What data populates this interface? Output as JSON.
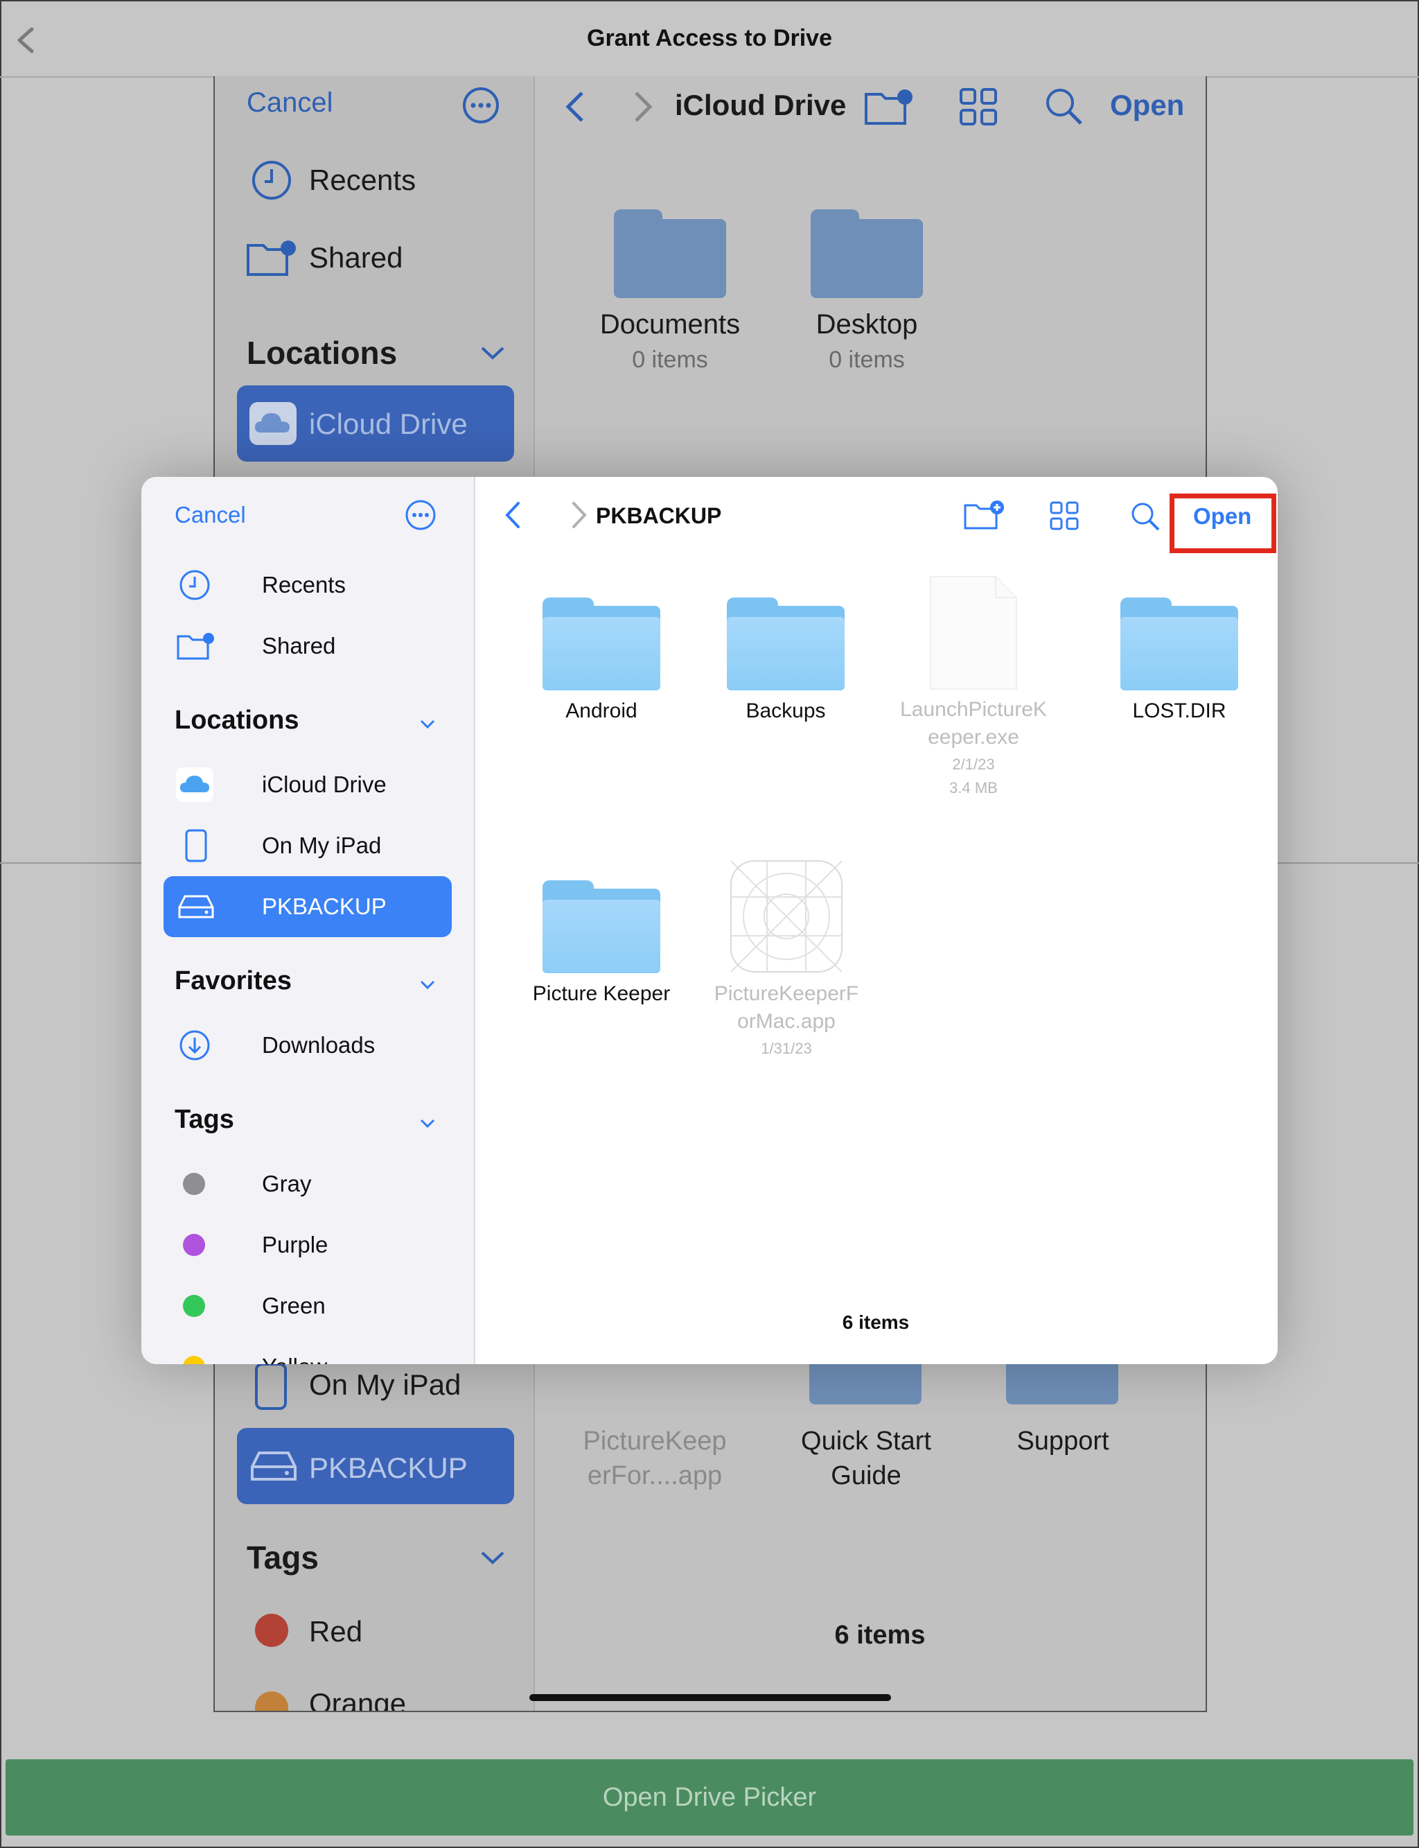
{
  "top_bar": {
    "title": "Grant Access to Drive"
  },
  "background_picker": {
    "cancel": "Cancel",
    "recents": "Recents",
    "shared": "Shared",
    "locations_header": "Locations",
    "icloud": "iCloud Drive",
    "on_my_ipad": "On My iPad",
    "pkbackup": "PKBACKUP",
    "tags_header": "Tags",
    "tag_red": "Red",
    "tag_orange": "Orange",
    "title": "iCloud Drive",
    "open": "Open",
    "folders": [
      {
        "name": "Documents",
        "meta": "0 items"
      },
      {
        "name": "Desktop",
        "meta": "0 items"
      }
    ],
    "lower_items": [
      {
        "name": "PictureKeep erFor....app"
      },
      {
        "name": "Quick Start Guide"
      },
      {
        "name": "Support"
      }
    ],
    "count": "6 items"
  },
  "modal": {
    "sidebar": {
      "cancel": "Cancel",
      "recents": "Recents",
      "shared": "Shared",
      "locations_header": "Locations",
      "locations": [
        "iCloud Drive",
        "On My iPad",
        "PKBACKUP"
      ],
      "favorites_header": "Favorites",
      "favorites": [
        "Downloads"
      ],
      "tags_header": "Tags",
      "tags": [
        {
          "name": "Gray",
          "color": "#8e8e93"
        },
        {
          "name": "Purple",
          "color": "#af52de"
        },
        {
          "name": "Green",
          "color": "#34c759"
        },
        {
          "name": "Yellow",
          "color": "#ffcc00"
        }
      ]
    },
    "toolbar": {
      "title": "PKBACKUP",
      "open": "Open"
    },
    "items": [
      {
        "name": "Android"
      },
      {
        "name": "Backups"
      },
      {
        "name": "LaunchPictureK eeper.exe",
        "date": "2/1/23",
        "size": "3.4 MB"
      },
      {
        "name": "LOST.DIR"
      },
      {
        "name": "Picture Keeper"
      },
      {
        "name": "PictureKeeperF orMac.app",
        "date": "1/31/23"
      }
    ],
    "count": "6 items"
  },
  "bottom_button": {
    "label": "Open Drive Picker"
  },
  "colors": {
    "accent": "#2f7bf6",
    "selected": "#3a82f6",
    "highlight": "#e0291c",
    "green_button": "#4a8c5f"
  }
}
